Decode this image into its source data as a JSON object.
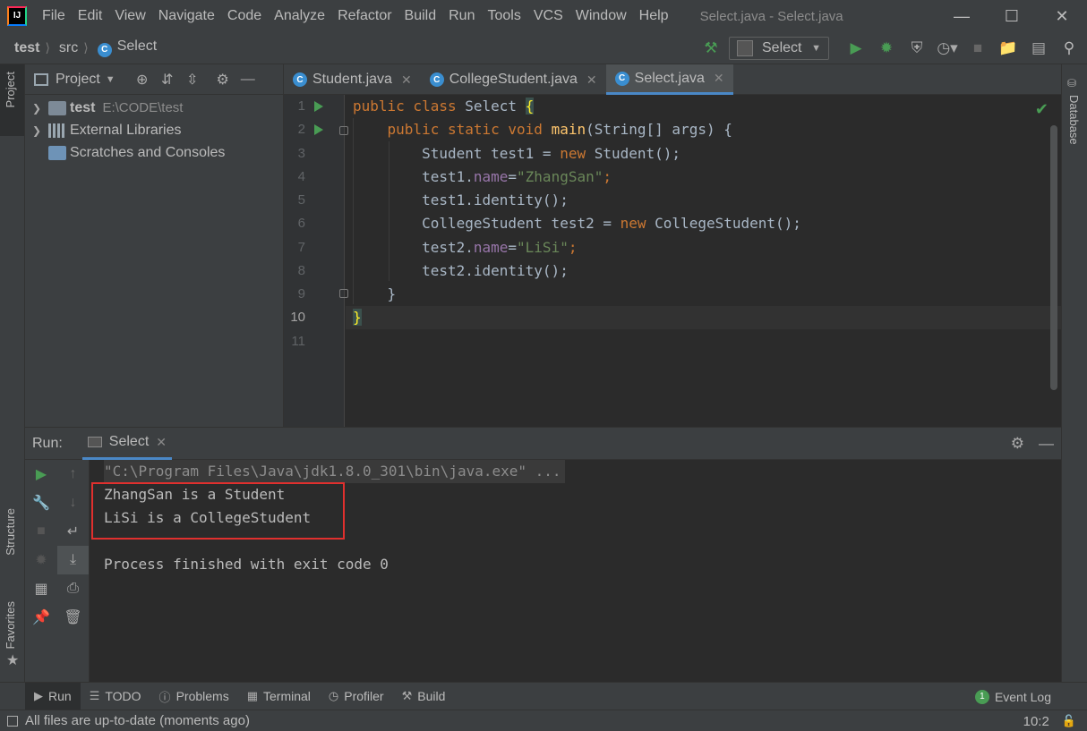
{
  "menubar": {
    "items": [
      "File",
      "Edit",
      "View",
      "Navigate",
      "Code",
      "Analyze",
      "Refactor",
      "Build",
      "Run",
      "Tools",
      "VCS",
      "Window",
      "Help"
    ],
    "window_title": "Select.java - Select.java",
    "logo": "IJ"
  },
  "navbar": {
    "crumbs": [
      "test",
      "src",
      "Select"
    ],
    "run_config": "Select"
  },
  "left_strip": {
    "project": "Project",
    "structure": "Structure",
    "favorites": "Favorites"
  },
  "right_strip": {
    "database": "Database"
  },
  "project_panel": {
    "title": "Project",
    "tree": [
      {
        "label": "test",
        "path": "E:\\CODE\\test"
      },
      {
        "label": "External Libraries"
      },
      {
        "label": "Scratches and Consoles"
      }
    ]
  },
  "editor_tabs": [
    {
      "label": "Student.java"
    },
    {
      "label": "CollegeStudent.java"
    },
    {
      "label": "Select.java"
    }
  ],
  "editor": {
    "line_numbers": [
      "1",
      "2",
      "3",
      "4",
      "5",
      "6",
      "7",
      "8",
      "9",
      "10",
      "11"
    ],
    "code": {
      "l1_kw": "public class ",
      "l1_cls": "Select ",
      "l1_brace": "{",
      "l2_indent": "    ",
      "l2_kw": "public static void ",
      "l2_fn": "main",
      "l2_rest": "(String[] args) {",
      "l3_a": "        Student test1 = ",
      "l3_kw": "new ",
      "l3_b": "Student();",
      "l4_a": "        test1.",
      "l4_fld": "name",
      "l4_b": "=",
      "l4_str": "\"ZhangSan\"",
      "l4_c": ";",
      "l5": "        test1.identity();",
      "l6_a": "        CollegeStudent test2 = ",
      "l6_kw": "new ",
      "l6_b": "CollegeStudent();",
      "l7_a": "        test2.",
      "l7_fld": "name",
      "l7_b": "=",
      "l7_str": "\"LiSi\"",
      "l7_c": ";",
      "l8": "        test2.identity();",
      "l9": "    }",
      "l10": "}"
    }
  },
  "run_panel": {
    "label": "Run:",
    "tab": "Select",
    "output": [
      "\"C:\\Program Files\\Java\\jdk1.8.0_301\\bin\\java.exe\" ...",
      "ZhangSan is a Student",
      "LiSi is a CollegeStudent",
      "",
      "Process finished with exit code 0"
    ]
  },
  "bottom_bar": {
    "items": [
      "Run",
      "TODO",
      "Problems",
      "Terminal",
      "Profiler",
      "Build"
    ],
    "event_log": "Event Log",
    "event_count": "1"
  },
  "status_bar": {
    "message": "All files are up-to-date (moments ago)",
    "position": "10:2"
  },
  "colors": {
    "accent": "#4a88c7",
    "run_green": "#499c54",
    "highlight_box": "#e0302e"
  }
}
